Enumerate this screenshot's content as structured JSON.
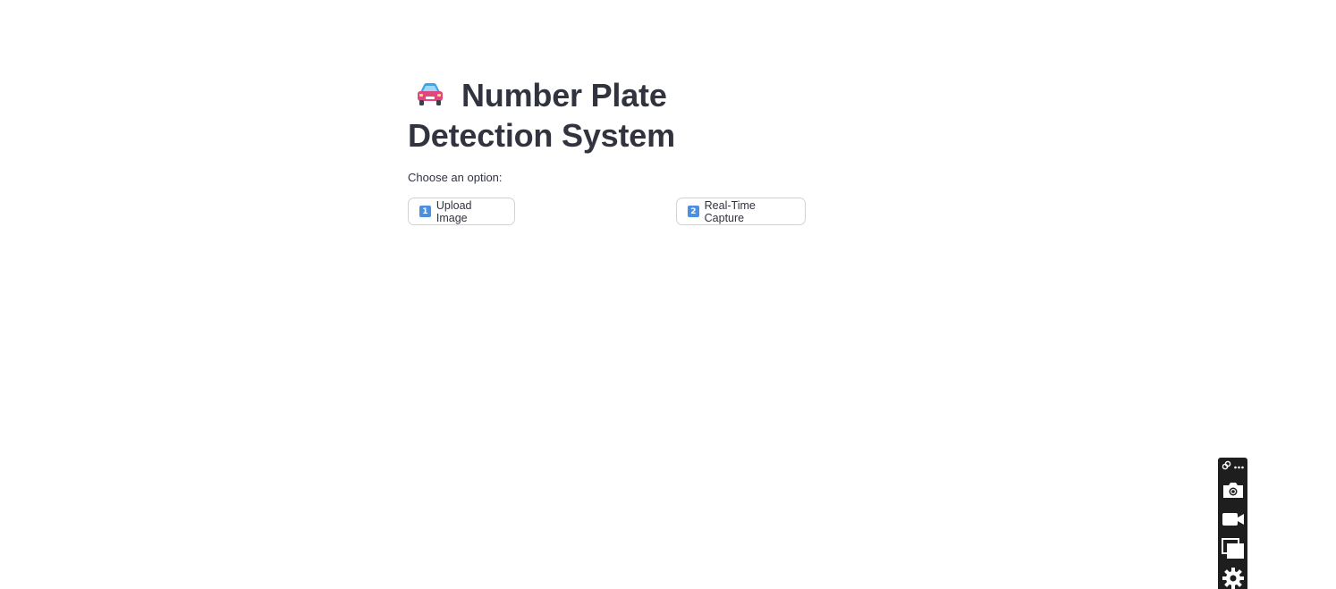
{
  "app": {
    "title": "Number Plate Detection System",
    "title_emoji": "car-emoji"
  },
  "main": {
    "prompt": "Choose an option:",
    "buttons": [
      {
        "keycap": "1",
        "label": "Upload Image"
      },
      {
        "keycap": "2",
        "label": "Real-Time Capture"
      }
    ]
  },
  "toolbar": {
    "icons": [
      "link-icon",
      "more-icon",
      "camera-icon",
      "video-icon",
      "windows-icon",
      "gear-icon"
    ]
  },
  "colors": {
    "text": "#31333f",
    "border": "#d0d2d8",
    "keycap": "#4a8fe0",
    "toolbar_bg": "#1e1e1e"
  }
}
